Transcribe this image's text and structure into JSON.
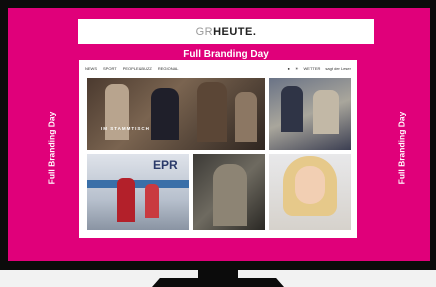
{
  "logo": {
    "prefix": "GR",
    "name": "HEUTE."
  },
  "branding": {
    "top": "Full Branding Day",
    "left": "Full Branding Day",
    "right": "Full Branding Day"
  },
  "nav": {
    "items": [
      "NEWS",
      "SPORT",
      "PEOPLE&BUZZ",
      "REGIONAL"
    ],
    "right": [
      "WETTER",
      "sagt der Leser"
    ]
  },
  "tiles": {
    "t1_caption": "IM STAMMTISCH",
    "t2_caption": "",
    "t3_caption": "",
    "t3_sign": "EPR",
    "t4_caption": "",
    "t5_caption": ""
  },
  "colors": {
    "brand": "#e0007a",
    "monitor": "#0b0b0b"
  }
}
